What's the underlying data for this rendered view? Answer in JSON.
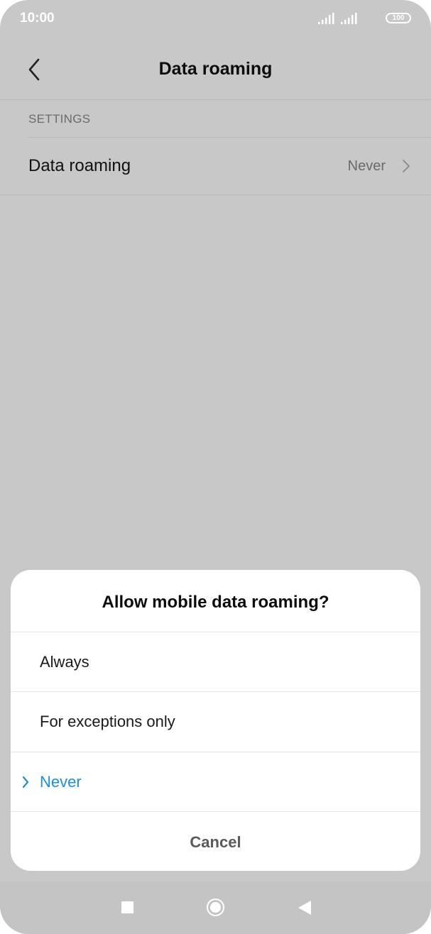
{
  "status_bar": {
    "time": "10:00",
    "battery": "100",
    "icons": [
      "signal-icon",
      "signal-icon",
      "battery-icon"
    ]
  },
  "header": {
    "title": "Data roaming",
    "back_icon": "back-chevron-icon"
  },
  "settings": {
    "section_label": "SETTINGS",
    "row": {
      "label": "Data roaming",
      "value": "Never",
      "icon": "chevron-right-icon"
    }
  },
  "dialog": {
    "title": "Allow mobile data roaming?",
    "options": [
      {
        "label": "Always",
        "selected": false
      },
      {
        "label": "For exceptions only",
        "selected": false
      },
      {
        "label": "Never",
        "selected": true
      }
    ],
    "cancel_label": "Cancel",
    "accent_color": "#1a8fe3"
  },
  "nav_bar": {
    "icons": [
      "recents-square-icon",
      "home-circle-icon",
      "back-triangle-icon"
    ]
  }
}
